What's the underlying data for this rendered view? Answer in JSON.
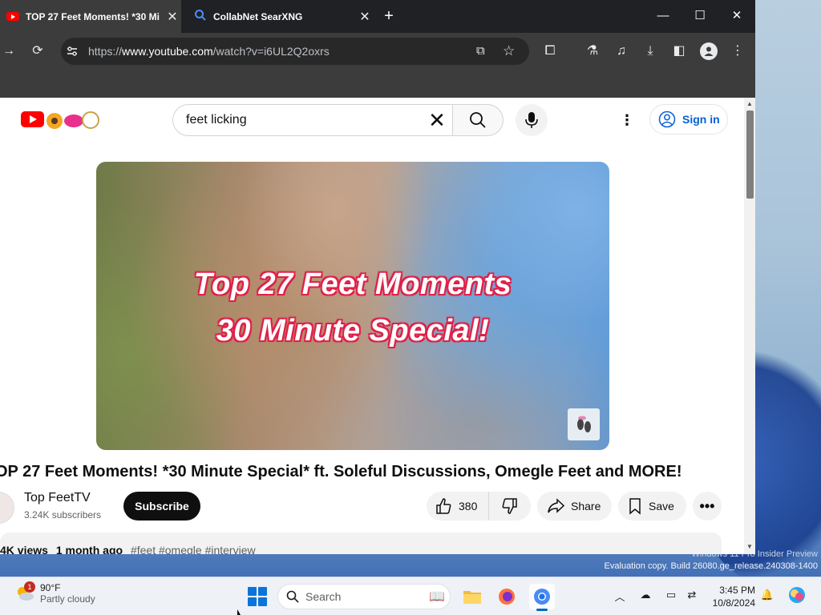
{
  "desktop": {
    "watermark_line1": "Windows 11 Pro Insider Preview",
    "watermark_line2": "Evaluation copy. Build 26080.ge_release.240308-1400"
  },
  "browser": {
    "tabs": [
      {
        "title": "TOP 27 Feet Moments! *30 Mi",
        "icon": "youtube-icon",
        "active": true
      },
      {
        "title": "CollabNet SearXNG",
        "icon": "search-icon",
        "active": false
      }
    ],
    "new_tab": "+",
    "window_controls": {
      "minimize": "—",
      "maximize": "☐",
      "close": "✕"
    },
    "url_prefix": "https://",
    "url_host": "www.youtube.com",
    "url_path": "/watch?v=i6UL2Q2oxrs"
  },
  "youtube": {
    "search_query": "feet licking",
    "sign_in": "Sign in",
    "video": {
      "overlay_line1": "Top 27 Feet Moments",
      "overlay_line2": "30 Minute Special!",
      "title": "OP 27 Feet Moments! *30 Minute Special* ft. Soleful Discussions, Omegle Feet and MORE!",
      "channel_name": "Top FeetTV",
      "subscribers": "3.24K subscribers",
      "subscribe": "Subscribe",
      "likes": "380",
      "share": "Share",
      "save": "Save",
      "more": "•••",
      "views": "4K views",
      "age": "1 month ago",
      "tags": "#feet #omegle #interview"
    }
  },
  "taskbar": {
    "weather_badge": "1",
    "temperature": "90°F",
    "condition": "Partly cloudy",
    "search_label": "Search",
    "time": "3:45 PM",
    "date": "10/8/2024"
  }
}
